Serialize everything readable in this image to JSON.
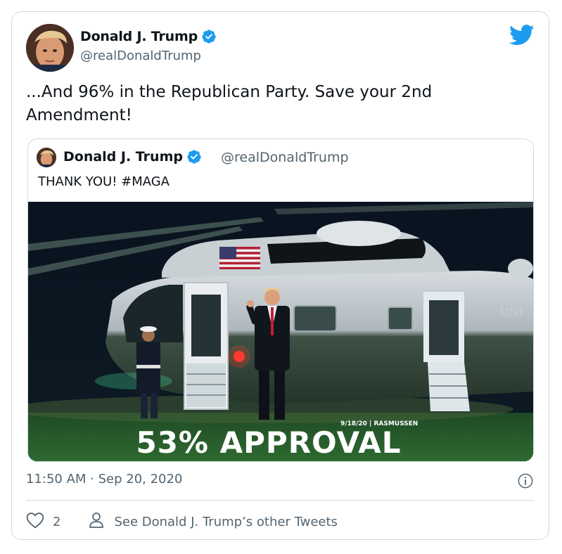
{
  "tweet": {
    "author_name": "Donald J. Trump",
    "author_handle": "@realDonaldTrump",
    "text": "...And 96% in the Republican Party. Save your 2nd Amendment!",
    "timestamp": "11:50 AM · Sep 20, 2020",
    "like_count": "2",
    "see_other_label": "See Donald J. Trump’s other Tweets"
  },
  "quoted_tweet": {
    "author_name": "Donald J. Trump",
    "author_handle": "@realDonaldTrump",
    "text": "THANK YOU! #MAGA",
    "image": {
      "caption_small": "9/18/20 | RASMUSSEN",
      "caption_large": "53% APPROVAL",
      "aircraft_marking": "UNI"
    }
  },
  "colors": {
    "verified_blue": "#1d9bf0",
    "twitter_blue": "#1d9bf0",
    "secondary_text": "#536471",
    "border": "#cfd9de"
  },
  "icons": [
    "verified-badge-icon",
    "twitter-bird-icon",
    "info-icon",
    "heart-icon",
    "person-icon"
  ]
}
